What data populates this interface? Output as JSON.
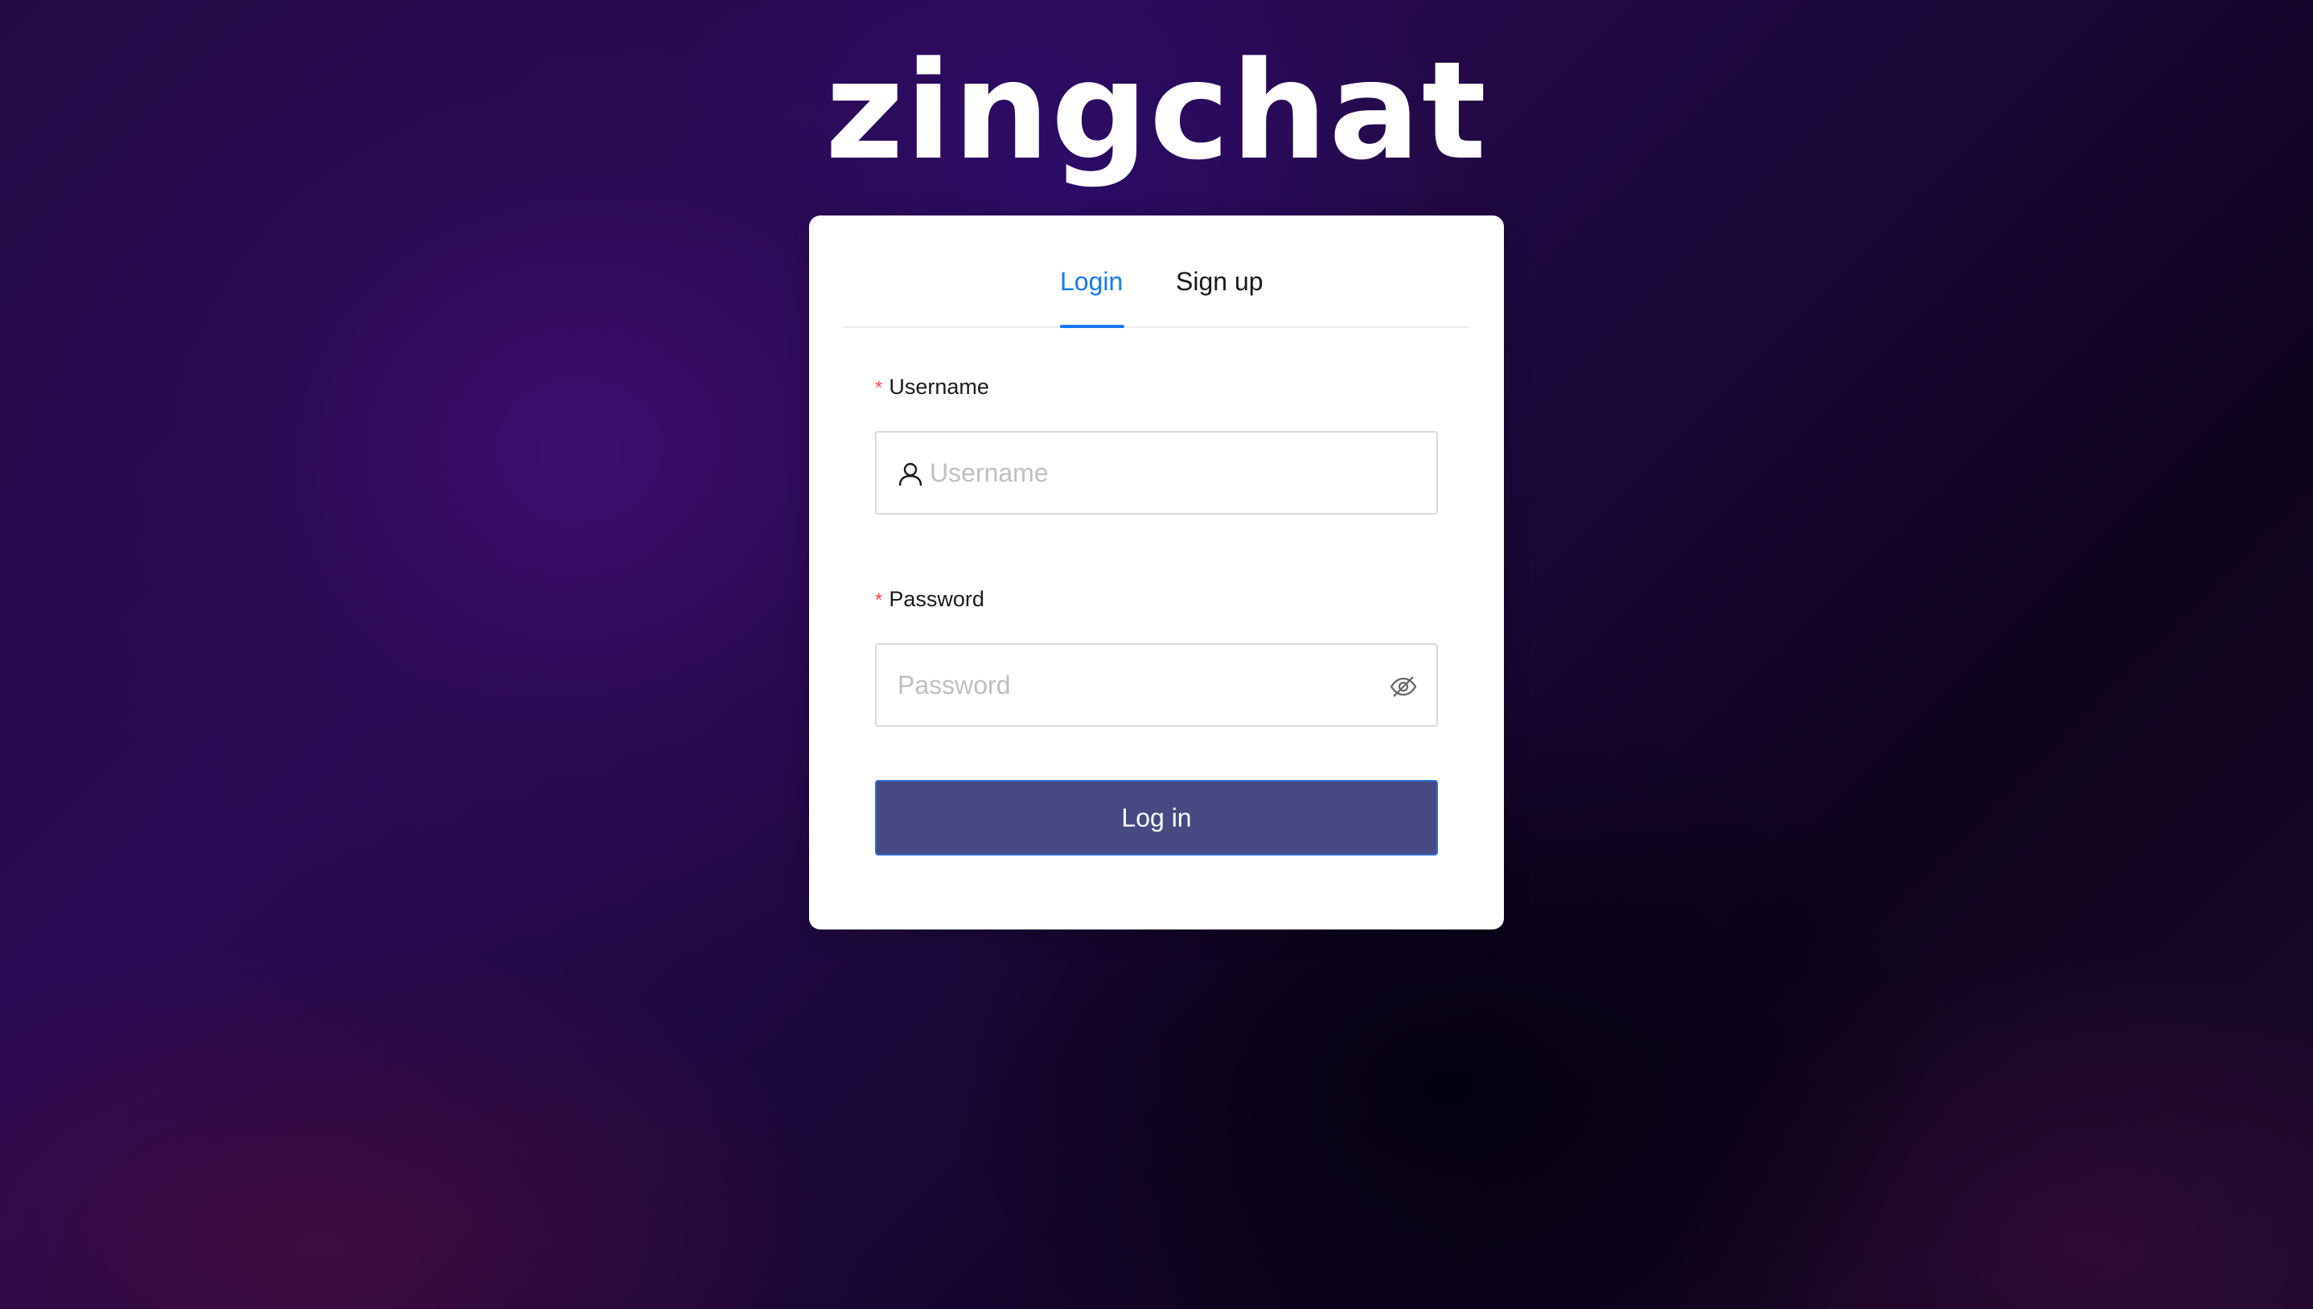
{
  "brand": {
    "logo_text": "zingchat"
  },
  "tabs": [
    {
      "label": "Login",
      "active": true
    },
    {
      "label": "Sign up",
      "active": false
    }
  ],
  "form": {
    "username": {
      "required_mark": "*",
      "label": "Username",
      "placeholder": "Username",
      "value": "",
      "icon": "user-icon"
    },
    "password": {
      "required_mark": "*",
      "label": "Password",
      "placeholder": "Password",
      "value": "",
      "icon": "eye-invisible-icon"
    },
    "submit_label": "Log in"
  },
  "colors": {
    "accent": "#1677ff",
    "button": "#474a82",
    "required": "#ff4d4f"
  }
}
